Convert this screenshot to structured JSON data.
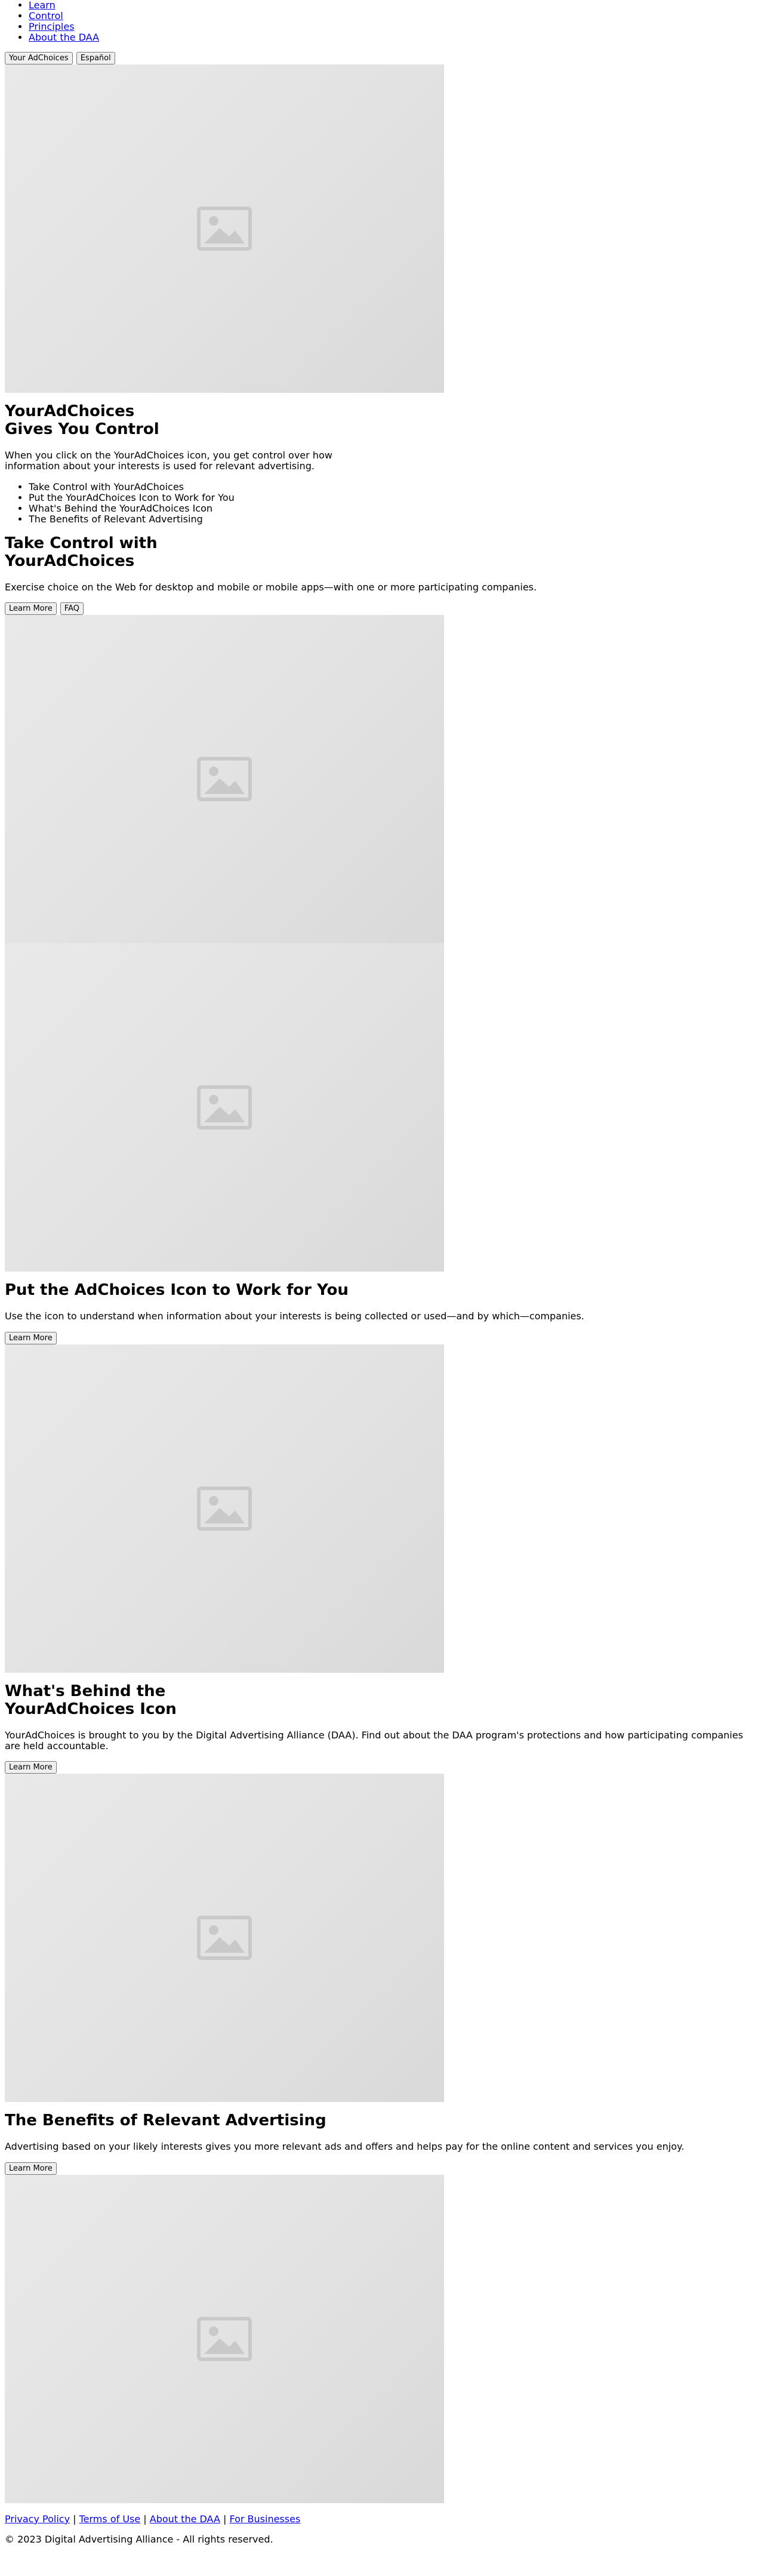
{
  "nav": {
    "items": [
      "Learn",
      "Control",
      "Principles",
      "About the DAA"
    ]
  },
  "lang_bar": {
    "primary_label": "Your AdChoices",
    "secondary_label": "Español"
  },
  "images": {
    "placeholder_icon": "image-placeholder-icon",
    "background": "#e4e4e4"
  },
  "hero": {
    "title_line1": "YourAdChoices",
    "title_line2": "Gives You Control",
    "intro": "When you click on the YourAdChoices icon, you get control over how information about your interests is used for relevant advertising.",
    "topics": [
      "Take Control with YourAdChoices",
      "Put the YourAdChoices Icon to Work for You",
      "What's Behind the YourAdChoices Icon",
      "The Benefits of Relevant Advertising"
    ]
  },
  "sections": {
    "control": {
      "title_line1": "Take Control with",
      "title_line2": "YourAdChoices",
      "text": "Exercise choice on the Web for desktop and mobile or mobile apps—with one or more participating companies.",
      "learn_more_label": "Learn More",
      "faq_label": "FAQ"
    },
    "icon": {
      "title": "Put the AdChoices Icon to Work for You",
      "text": "Use the icon to understand when information about your interests is being collected or used—and by which—companies.",
      "learn_more_label": "Learn More"
    },
    "behind": {
      "title_line1": "What's Behind the",
      "title_line2": "YourAdChoices Icon",
      "text": "YourAdChoices is brought to you by the Digital Advertising Alliance (DAA). Find out about the DAA program's protections and how participating companies are held accountable.",
      "learn_more_label": "Learn More"
    },
    "benefits": {
      "title": "The Benefits of Relevant Advertising",
      "text": "Advertising based on your likely interests gives you more relevant ads and offers and helps pay for the online content and services you enjoy.",
      "learn_more_label": "Learn More"
    }
  },
  "footer": {
    "links": [
      "Privacy Policy",
      "Terms of Use",
      "About the DAA",
      "For Businesses"
    ],
    "separator": " | ",
    "copyright": "© 2023 Digital Advertising Alliance - All rights reserved."
  }
}
